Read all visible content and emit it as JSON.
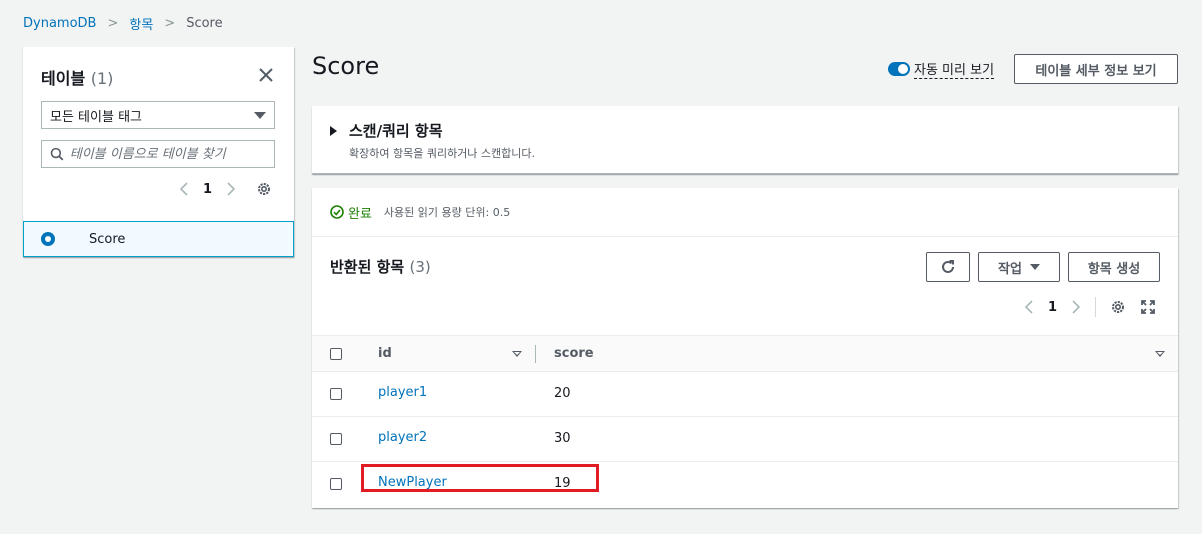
{
  "breadcrumb": {
    "root": "DynamoDB",
    "section": "항목",
    "current": "Score"
  },
  "left_panel": {
    "title": "테이블",
    "count": "(1)",
    "tag_filter": "모든 테이블 태그",
    "search_placeholder": "테이블 이름으로 테이블 찾기",
    "page": "1",
    "tables": [
      {
        "name": "Score",
        "selected": true
      }
    ]
  },
  "main": {
    "title": "Score",
    "auto_preview_label": "자동 미리 보기",
    "auto_preview_on": true,
    "table_details_button": "테이블 세부 정보 보기",
    "scan": {
      "title": "스캔/쿼리 항목",
      "description": "확장하여 항목을 쿼리하거나 스캔합니다."
    },
    "status": {
      "state": "완료",
      "consumed": "사용된 읽기 용량 단위: 0.5"
    },
    "results": {
      "title": "반환된 항목",
      "count": "(3)",
      "actions_button": "작업",
      "create_button": "항목 생성",
      "page": "1",
      "columns": [
        "id",
        "score"
      ],
      "rows": [
        {
          "id": "player1",
          "score": "20"
        },
        {
          "id": "player2",
          "score": "30"
        },
        {
          "id": "NewPlayer",
          "score": "19"
        }
      ]
    }
  },
  "colors": {
    "link": "#0073bb",
    "success": "#1d8102",
    "highlight": "#e21c23",
    "selected_border": "#00a1c9"
  }
}
